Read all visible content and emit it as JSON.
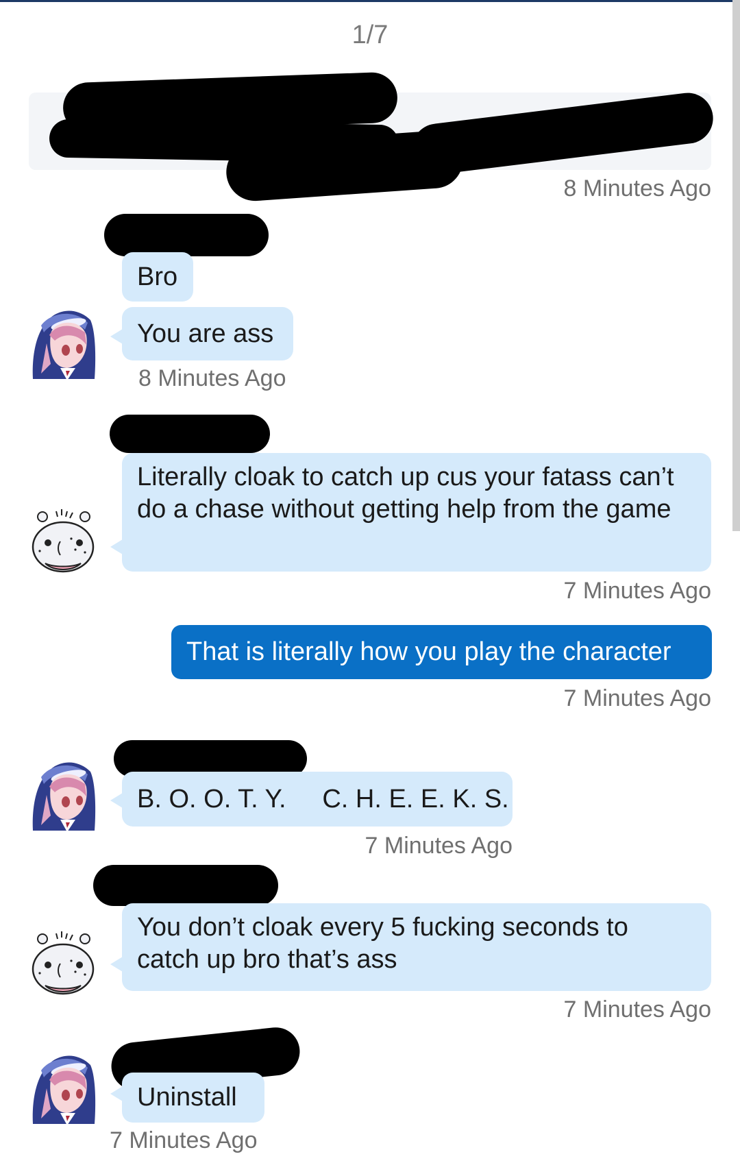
{
  "pager": "1/7",
  "colors": {
    "bubble_in": "#d5eafb",
    "bubble_out": "#0a70c6",
    "timestamp": "#6f6f6f",
    "redaction": "#000000"
  },
  "avatars": {
    "a": "anime-girl-avatar",
    "b": "hippo-avatar"
  },
  "preview": {
    "time": "8 Minutes Ago"
  },
  "messages": [
    {
      "text": "Bro"
    },
    {
      "text": "You are ass",
      "time": "8 Minutes Ago"
    },
    {
      "text": "Literally cloak to catch up cus your fatass can’t do a chase without getting help from the game",
      "time": "7 Minutes Ago"
    },
    {
      "text": "That is literally how you play the character",
      "time": "7 Minutes Ago"
    },
    {
      "text": "B. O. O. T. Y.     C. H. E. E. K. S.",
      "time": "7 Minutes Ago"
    },
    {
      "text": "You don’t cloak every 5 fucking seconds to catch up bro that’s ass",
      "time": "7 Minutes Ago"
    },
    {
      "text": "Uninstall",
      "time": "7 Minutes Ago"
    }
  ]
}
